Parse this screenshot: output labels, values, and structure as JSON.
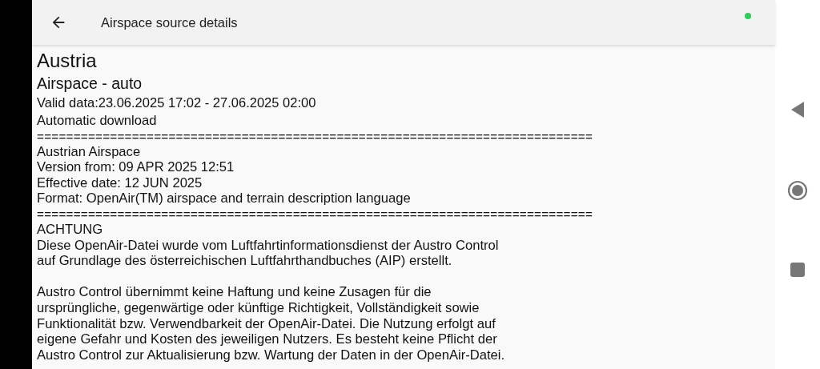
{
  "app_bar": {
    "title": "Airspace source details",
    "online": true
  },
  "content": [
    {
      "kind": "title",
      "lines": [
        "Austria"
      ]
    },
    {
      "kind": "subtitle",
      "lines": [
        "Airspace - auto"
      ]
    },
    {
      "kind": "text",
      "lines": [
        "Valid data:23.06.2025 17:02 - 27.06.2025 02:00"
      ]
    },
    {
      "kind": "text",
      "lines": [
        "Automatic download"
      ]
    },
    {
      "kind": "separator",
      "lines": [
        "============================================================================"
      ]
    },
    {
      "kind": "text",
      "lines": [
        "Austrian Airspace"
      ]
    },
    {
      "kind": "text",
      "lines": [
        "Version from: 09 APR 2025 12:51"
      ]
    },
    {
      "kind": "text",
      "lines": [
        "Effective date: 12 JUN 2025"
      ]
    },
    {
      "kind": "text",
      "lines": [
        "Format: OpenAir(TM) airspace and terrain description language"
      ]
    },
    {
      "kind": "separator",
      "lines": [
        "============================================================================"
      ]
    },
    {
      "kind": "text",
      "lines": [
        "ACHTUNG"
      ]
    },
    {
      "kind": "paragraph",
      "lines": [
        "Diese OpenAir-Datei wurde vom Luftfahrtinformationsdienst der Austro Control",
        "auf Grundlage des österreichischen Luftfahrthandbuches (AIP) erstellt."
      ]
    },
    {
      "kind": "paragraph",
      "lines": [
        "Austro Control übernimmt keine Haftung und keine Zusagen für die",
        "ursprüngliche, gegenwärtige oder künftige Richtigkeit, Vollständigkeit sowie",
        "Funktionalität bzw. Verwendbarkeit der OpenAir-Datei. Die Nutzung erfolgt auf",
        "eigene Gefahr und Kosten des jeweiligen Nutzers. Es besteht keine Pflicht der",
        "Austro Control zur Aktualisierung bzw. Wartung der Daten in der OpenAir-Datei."
      ]
    }
  ]
}
